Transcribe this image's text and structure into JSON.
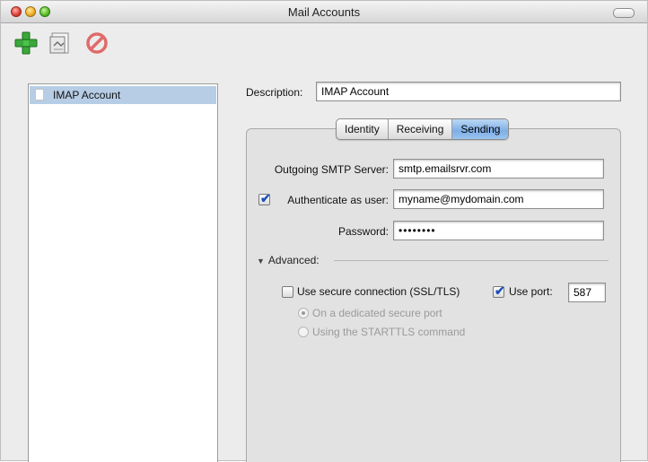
{
  "window": {
    "title": "Mail Accounts"
  },
  "toolbar": {
    "add_icon": "plus-icon",
    "edit_icon": "document-edit-icon",
    "remove_icon": "no-entry-icon"
  },
  "sidebar": {
    "items": [
      {
        "label": "IMAP Account",
        "icon": "document-icon",
        "selected": true
      }
    ]
  },
  "description": {
    "label": "Description:",
    "value": "IMAP Account"
  },
  "tabs": [
    {
      "label": "Identity",
      "active": false
    },
    {
      "label": "Receiving",
      "active": false
    },
    {
      "label": "Sending",
      "active": true
    }
  ],
  "sending": {
    "smtp_label": "Outgoing SMTP Server:",
    "smtp_value": "smtp.emailsrvr.com",
    "auth_label": "Authenticate as user:",
    "auth_checked": true,
    "auth_value": "myname@mydomain.com",
    "password_label": "Password:",
    "password_value": "••••••••",
    "advanced_label": "Advanced:",
    "ssl_label": "Use secure connection (SSL/TLS)",
    "ssl_checked": false,
    "port_label": "Use port:",
    "port_checked": true,
    "port_value": "587",
    "radio_dedicated": "On a dedicated secure port",
    "radio_starttls": "Using the STARTTLS command"
  },
  "colors": {
    "selection": "#b7cde6",
    "active_tab": "#7eaee6",
    "checkmark": "#1d4fb8"
  }
}
